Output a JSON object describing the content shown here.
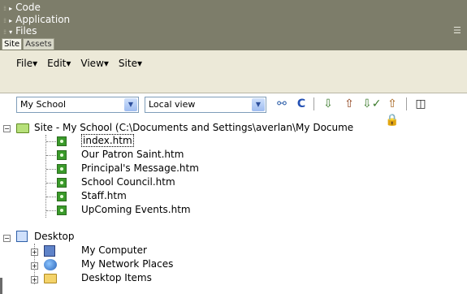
{
  "panel": {
    "groups": [
      {
        "label": "Code",
        "expanded": false
      },
      {
        "label": "Application",
        "expanded": false
      },
      {
        "label": "Files",
        "expanded": true
      }
    ],
    "tabs": [
      "Site",
      "Assets"
    ],
    "options_icon": "options-menu-icon"
  },
  "menubar": {
    "items": [
      "File",
      "Edit",
      "View",
      "Site"
    ]
  },
  "toolbar": {
    "site_select": "My School",
    "view_select": "Local view",
    "icons": [
      "connect-icon",
      "refresh-icon",
      "get-icon",
      "put-icon",
      "check-out-icon",
      "check-in-icon",
      "expand-icon"
    ]
  },
  "tree": {
    "site_root": "Site - My School (C:\\Documents and Settings\\averlan\\My Docume",
    "files": [
      "index.htm",
      "Our Patron Saint.htm",
      "Principal's Message.htm",
      "School Council.htm",
      "Staff.htm",
      "UpComing Events.htm"
    ],
    "desktop": "Desktop",
    "desktop_children": [
      "My Computer",
      "My Network Places",
      "Desktop Items"
    ]
  },
  "colors": {
    "panel_header": "#7d7d6a",
    "menubar": "#ece9d8",
    "file_icon": "#3a9a2a"
  }
}
